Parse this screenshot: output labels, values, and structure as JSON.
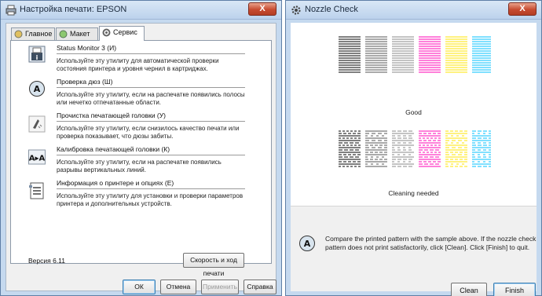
{
  "left_window": {
    "title": "Настройка печати: EPSON",
    "close_label": "X",
    "tabs": [
      "Главное",
      "Макет",
      "Сервис"
    ],
    "utilities": [
      {
        "title": "Status Monitor 3 (И)",
        "description": "Используйте эту утилиту для автоматической проверки состояния принтера и уровня чернил в картриджах.",
        "icon": "status-monitor-icon"
      },
      {
        "title": "Проверка дюз (Ш)",
        "description": "Используйте эту утилиту, если на распечатке появились полосы или нечетко отпечатанные области.",
        "icon": "nozzle-check-icon"
      },
      {
        "title": "Прочистка печатающей головки (У)",
        "description": "Используйте эту утилиту, если снизилось качество печати или проверка показывает, что дюзы забиты.",
        "icon": "head-cleaning-icon"
      },
      {
        "title": "Калибровка печатающей головки (К)",
        "description": "Используйте эту утилиту, если на распечатке появились разрывы вертикальных линий.",
        "icon": "head-alignment-icon"
      },
      {
        "title": "Информация о принтере и опциях (Е)",
        "description": "Используйте эту утилиту для установки и проверки параметров принтера и дополнительных устройств.",
        "icon": "printer-info-icon"
      }
    ],
    "version": "Версия 6.11",
    "speed_button": "Скорость и ход печати",
    "buttons": {
      "ok": "ОК",
      "cancel": "Отмена",
      "apply": "Применить",
      "help": "Справка"
    }
  },
  "right_window": {
    "title": "Nozzle Check",
    "close_label": "X",
    "good_label": "Good",
    "cleaning_label": "Cleaning needed",
    "info_text": "Compare the printed pattern with the sample above. If the nozzle check pattern does not print satisfactorily, click [Clean]. Click [Finish] to quit.",
    "buttons": {
      "clean": "Clean",
      "finish": "Finish"
    },
    "pattern_colors": [
      "#000000",
      "#555555",
      "#888888",
      "#ff00b4",
      "#ffe600",
      "#00c0ff"
    ]
  }
}
